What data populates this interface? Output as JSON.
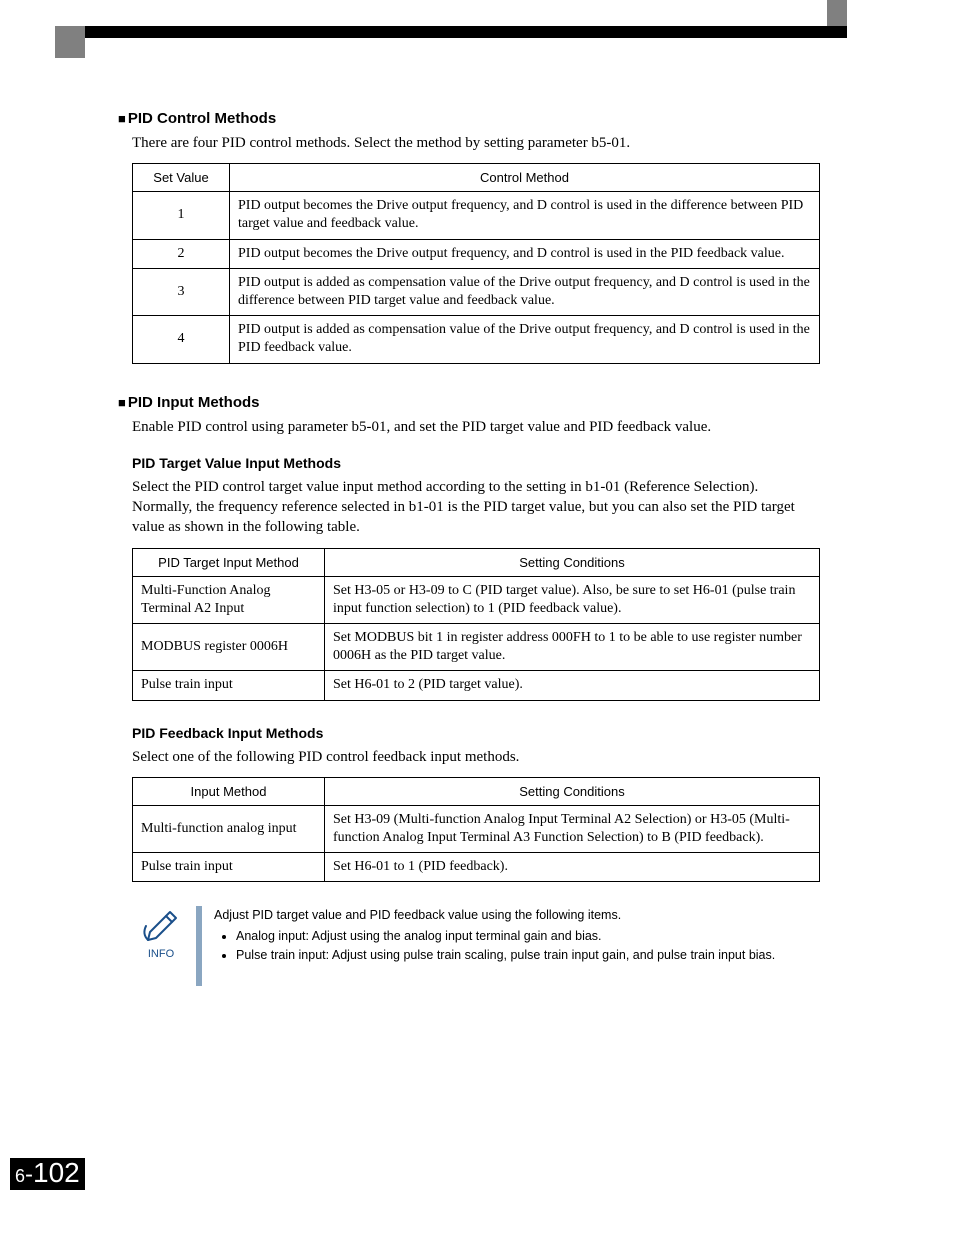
{
  "sections": {
    "s1": {
      "title": "PID Control Methods",
      "intro": "There are four PID control methods. Select the method by setting parameter b5-01."
    },
    "s2": {
      "title": "PID Input Methods",
      "intro": "Enable PID control using parameter b5-01, and set the PID target value and PID feedback value."
    },
    "sub1": {
      "title": "PID Target Value Input Methods",
      "intro": "Select the PID control target value input method according to the setting in b1-01 (Reference Selection). Normally, the frequency reference selected in b1-01 is the PID target value, but you can also set the PID target value as shown in the following table."
    },
    "sub2": {
      "title": "PID Feedback Input Methods",
      "intro": "Select one of the following PID control feedback input methods."
    }
  },
  "table1": {
    "headers": [
      "Set Value",
      "Control Method"
    ],
    "rows": [
      {
        "v": "1",
        "m": "PID output becomes the Drive output frequency, and D control is used in the difference between PID target value and feedback value."
      },
      {
        "v": "2",
        "m": "PID output becomes the Drive output frequency, and D control is used in the PID feedback value."
      },
      {
        "v": "3",
        "m": "PID output is added as compensation value of the Drive output frequency, and D control is used in the difference between PID target value and feedback value."
      },
      {
        "v": "4",
        "m": "PID output is added as compensation value of the Drive output frequency, and D control is used in the PID feedback value."
      }
    ]
  },
  "table2": {
    "headers": [
      "PID Target Input Method",
      "Setting Conditions"
    ],
    "rows": [
      {
        "m": "Multi-Function Analog Terminal A2 Input",
        "c": "Set H3-05 or H3-09 to C (PID target value). Also, be sure to set H6-01 (pulse train input function selection) to 1 (PID feedback value)."
      },
      {
        "m": "MODBUS register 0006H",
        "c": "Set MODBUS bit 1 in register address 000FH to 1 to be able to use register number 0006H as the PID target value."
      },
      {
        "m": "Pulse train input",
        "c": "Set H6-01 to 2 (PID target value)."
      }
    ]
  },
  "table3": {
    "headers": [
      "Input Method",
      "Setting Conditions"
    ],
    "rows": [
      {
        "m": "Multi-function analog input",
        "c": "Set H3-09 (Multi-function Analog Input Terminal A2 Selection) or H3-05 (Multi-function Analog Input Terminal A3 Function Selection) to B (PID feedback)."
      },
      {
        "m": "Pulse train input",
        "c": "Set H6-01 to 1 (PID feedback)."
      }
    ]
  },
  "info": {
    "label": "INFO",
    "lead": "Adjust PID target value and PID feedback value using the following items.",
    "b1": "Analog input: Adjust using the analog input terminal gain and bias.",
    "b2": "Pulse train input: Adjust using pulse train scaling, pulse train input gain, and pulse train input bias."
  },
  "page": {
    "chapter": "6",
    "number": "102"
  }
}
